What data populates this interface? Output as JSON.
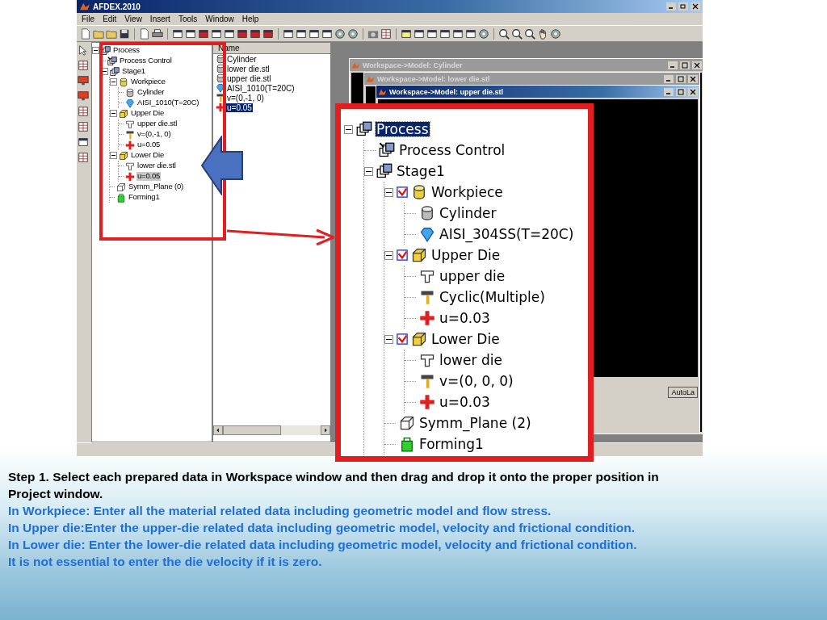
{
  "window": {
    "title": "AFDEX.2010"
  },
  "menu": [
    "File",
    "Edit",
    "View",
    "Insert",
    "Tools",
    "Window",
    "Help"
  ],
  "project_tree": {
    "items": [
      {
        "label": "Process",
        "kind": "process",
        "selected": false,
        "expanded": true,
        "children": [
          {
            "label": "Process Control",
            "kind": "control",
            "selected": false
          },
          {
            "label": "Stage1",
            "kind": "stage",
            "selected": false,
            "expanded": true,
            "children": [
              {
                "label": "Workpiece",
                "kind": "workpiece",
                "selected": false,
                "expanded": true,
                "children": [
                  {
                    "label": "Cylinder",
                    "kind": "cylinder",
                    "selected": false
                  },
                  {
                    "label": "AISI_1010(T=20C)",
                    "kind": "material",
                    "selected": false
                  }
                ]
              },
              {
                "label": "Upper Die",
                "kind": "upperdie",
                "selected": false,
                "expanded": true,
                "children": [
                  {
                    "label": "upper die.stl",
                    "kind": "shape",
                    "selected": false
                  },
                  {
                    "label": "v=(0,-1, 0)",
                    "kind": "velocity",
                    "selected": false
                  },
                  {
                    "label": "u=0.05",
                    "kind": "friction",
                    "selected": false
                  }
                ]
              },
              {
                "label": "Lower Die",
                "kind": "lowerdie",
                "selected": false,
                "expanded": true,
                "children": [
                  {
                    "label": "lower die.stl",
                    "kind": "lowershape",
                    "selected": false
                  },
                  {
                    "label": "u=0.05",
                    "kind": "friction",
                    "selected": true
                  }
                ]
              },
              {
                "label": "Symm_Plane (0)",
                "kind": "plane",
                "selected": false
              },
              {
                "label": "Forming1",
                "kind": "forming",
                "selected": false
              }
            ]
          }
        ]
      }
    ]
  },
  "workspace_list": {
    "header": "Name",
    "items": [
      {
        "label": "Cylinder",
        "kind": "cylinder",
        "selected": false
      },
      {
        "label": "lower die.stl",
        "kind": "cylinder",
        "selected": false
      },
      {
        "label": "upper die.stl",
        "kind": "cylinder",
        "selected": false
      },
      {
        "label": "AISI_1010(T=20C)",
        "kind": "material",
        "selected": false
      },
      {
        "label": "v=(0,-1, 0)",
        "kind": "velocity",
        "selected": false
      },
      {
        "label": "u=0.05",
        "kind": "friction",
        "selected": true
      }
    ]
  },
  "model_windows": [
    {
      "title": "Workspace->Model: Cylinder",
      "active": false
    },
    {
      "title": "Workspace->Model: lower die.stl",
      "active": false
    },
    {
      "title": "Workspace->Model: upper die.stl",
      "active": true
    }
  ],
  "auto_button": "AutoLa",
  "zoomed_tree": {
    "items": [
      {
        "label": "Process",
        "kind": "process",
        "selected": true,
        "expanded": true,
        "children": [
          {
            "label": "Process Control",
            "kind": "control",
            "selected": false
          },
          {
            "label": "Stage1",
            "kind": "stage",
            "selected": false,
            "expanded": true,
            "children": [
              {
                "label": "Workpiece",
                "kind": "workpiece",
                "selected": false,
                "checked": true,
                "expanded": true,
                "children": [
                  {
                    "label": "Cylinder",
                    "kind": "cylinder",
                    "selected": false
                  },
                  {
                    "label": "AISI_304SS(T=20C)",
                    "kind": "material",
                    "selected": false
                  }
                ]
              },
              {
                "label": "Upper Die",
                "kind": "upperdie",
                "selected": false,
                "checked": true,
                "expanded": true,
                "children": [
                  {
                    "label": "upper die",
                    "kind": "shape",
                    "selected": false
                  },
                  {
                    "label": "Cyclic(Multiple)",
                    "kind": "velocity",
                    "selected": false
                  },
                  {
                    "label": "u=0.03",
                    "kind": "friction",
                    "selected": false
                  }
                ]
              },
              {
                "label": "Lower Die",
                "kind": "lowerdie",
                "selected": false,
                "checked": true,
                "expanded": true,
                "children": [
                  {
                    "label": "lower die",
                    "kind": "lowershape",
                    "selected": false
                  },
                  {
                    "label": "v=(0, 0, 0)",
                    "kind": "velocity",
                    "selected": false
                  },
                  {
                    "label": "u=0.03",
                    "kind": "friction",
                    "selected": false
                  }
                ]
              },
              {
                "label": "Symm_Plane (2)",
                "kind": "plane",
                "selected": false,
                "checked": false
              },
              {
                "label": "Forming1",
                "kind": "forming",
                "selected": false,
                "checked": false
              }
            ]
          }
        ]
      }
    ]
  },
  "caption": [
    {
      "kind": "step",
      "text": "Step 1. Select each prepared data in Workspace window and then drag and drop it onto the proper position in Project window."
    },
    {
      "kind": "note",
      "text": "In Workpiece: Enter all the material related data including geometric model and flow stress."
    },
    {
      "kind": "note",
      "text": "In Upper die:Enter the upper-die related data including geometric model, velocity and frictional condition."
    },
    {
      "kind": "note",
      "text": "In Lower die: Enter the lower-die related data including geometric model, velocity and frictional condition."
    },
    {
      "kind": "note",
      "text": "It is not essential to enter the die velocity if it is zero."
    }
  ]
}
